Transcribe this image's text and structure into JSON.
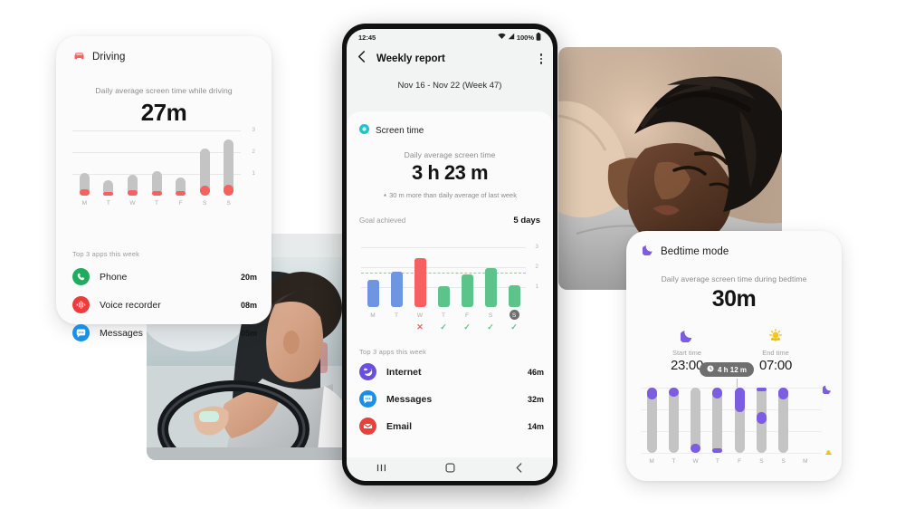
{
  "driving_card": {
    "icon": "car-icon",
    "title": "Driving",
    "accent": "#f4615e",
    "avg_label": "Daily average screen time while driving",
    "avg_value": "27m",
    "chart": {
      "type": "bar",
      "categories": [
        "M",
        "T",
        "W",
        "T",
        "F",
        "S",
        "S"
      ],
      "values": [
        1.05,
        0.72,
        0.95,
        1.12,
        0.82,
        2.15,
        2.6
      ],
      "red_values": [
        0.28,
        0.18,
        0.25,
        0.22,
        0.22,
        0.45,
        0.52
      ],
      "yticks": [
        "3",
        "2",
        "1"
      ],
      "ylim": [
        0,
        3
      ],
      "bar_color": "#c4c4c4",
      "segment_color": "#f4615e"
    },
    "top3_label": "Top 3 apps this week",
    "apps": [
      {
        "name": "Phone",
        "time": "20m",
        "icon": "phone-icon",
        "color": "#22ab5c"
      },
      {
        "name": "Voice recorder",
        "time": "08m",
        "icon": "voice-recorder-icon",
        "color": "#ea3d3d"
      },
      {
        "name": "Messages",
        "time": "05m",
        "icon": "messages-icon",
        "color": "#1a8fe8"
      }
    ]
  },
  "phone": {
    "statusbar": {
      "time": "12:45",
      "wifi": "wifi-icon",
      "signal": "signal-icon",
      "battery_pct": "100%",
      "battery": "battery-icon"
    },
    "appbar": {
      "back": "back-chevron-icon",
      "title": "Weekly report",
      "menu": "overflow-menu-icon"
    },
    "week_range": "Nov 16 - Nov 22 (Week 47)",
    "section": {
      "icon": "clock-icon",
      "icon_color": "#19c5c5",
      "title": "Screen time"
    },
    "avg_label": "Daily average screen time",
    "avg_value": "3 h 23 m",
    "delta_text": "30 m more than daily average of last week",
    "delta_arrow": "▲",
    "goal_label": "Goal achieved",
    "goal_value": "5 days",
    "chart": {
      "type": "bar",
      "categories": [
        "M",
        "T",
        "W",
        "T",
        "F",
        "S",
        "S"
      ],
      "values": [
        1.35,
        1.78,
        2.45,
        1.05,
        1.62,
        1.95,
        1.08
      ],
      "colors": [
        "#6f95e2",
        "#6f95e2",
        "#f4615e",
        "#5cc48a",
        "#5cc48a",
        "#5cc48a",
        "#5cc48a"
      ],
      "marks": [
        "",
        "",
        "✕",
        "✓",
        "✓",
        "✓",
        "✓"
      ],
      "mark_colors": [
        "",
        "",
        "#f4615e",
        "#5cc48a",
        "#5cc48a",
        "#5cc48a",
        "#5cc48a"
      ],
      "today_index": 6,
      "yticks": [
        "3",
        "2",
        "1"
      ],
      "ylim": [
        0,
        3
      ],
      "goal_value": 1.75
    },
    "top3_label": "Top 3 apps this week",
    "apps": [
      {
        "name": "Internet",
        "time": "46m",
        "icon": "internet-icon",
        "color": "#6a4fe0"
      },
      {
        "name": "Messages",
        "time": "32m",
        "icon": "messages-icon",
        "color": "#1a8fe8"
      },
      {
        "name": "Email",
        "time": "14m",
        "icon": "email-icon",
        "color": "#e8403a"
      }
    ],
    "navbar": {
      "recents": "recents-icon",
      "home": "home-icon",
      "back": "back-icon"
    }
  },
  "bedtime_card": {
    "icon": "moon-icon",
    "title": "Bedtime mode",
    "accent": "#7c5ce0",
    "avg_label": "Daily average screen time during bedtime",
    "avg_value": "30m",
    "start": {
      "icon": "moon-icon",
      "label": "Start time",
      "value": "23:00"
    },
    "end": {
      "icon": "sun-icon",
      "label": "End time",
      "value": "07:00"
    },
    "duration_pill": {
      "icon": "clock-icon",
      "text": "4 h 12 m"
    },
    "chart": {
      "type": "bar",
      "categories": [
        "M",
        "T",
        "W",
        "T",
        "F",
        "S",
        "S",
        "M"
      ],
      "track_color": "#c4c4c4",
      "segment_color": "#7c5ce0",
      "segments": [
        [
          {
            "start": 0.82,
            "end": 1.0
          }
        ],
        [
          {
            "start": 0.86,
            "end": 1.0
          }
        ],
        [
          {
            "start": 0.0,
            "end": 0.14
          }
        ],
        [
          {
            "start": 0.0,
            "end": 0.07
          },
          {
            "start": 0.84,
            "end": 1.0
          }
        ],
        [
          {
            "start": 0.62,
            "end": 1.0
          }
        ],
        [
          {
            "start": 0.95,
            "end": 1.0
          },
          {
            "start": 0.44,
            "end": 0.62
          }
        ],
        [
          {
            "start": 0.82,
            "end": 1.0
          }
        ],
        []
      ],
      "marker_moon": "moon-icon",
      "marker_sun": "sun-icon"
    }
  },
  "photos": [
    {
      "name": "driving-photo",
      "alt": "Person driving a car holding steering wheel"
    },
    {
      "name": "sleeping-photo",
      "alt": "Woman sleeping on a pillow"
    }
  ]
}
